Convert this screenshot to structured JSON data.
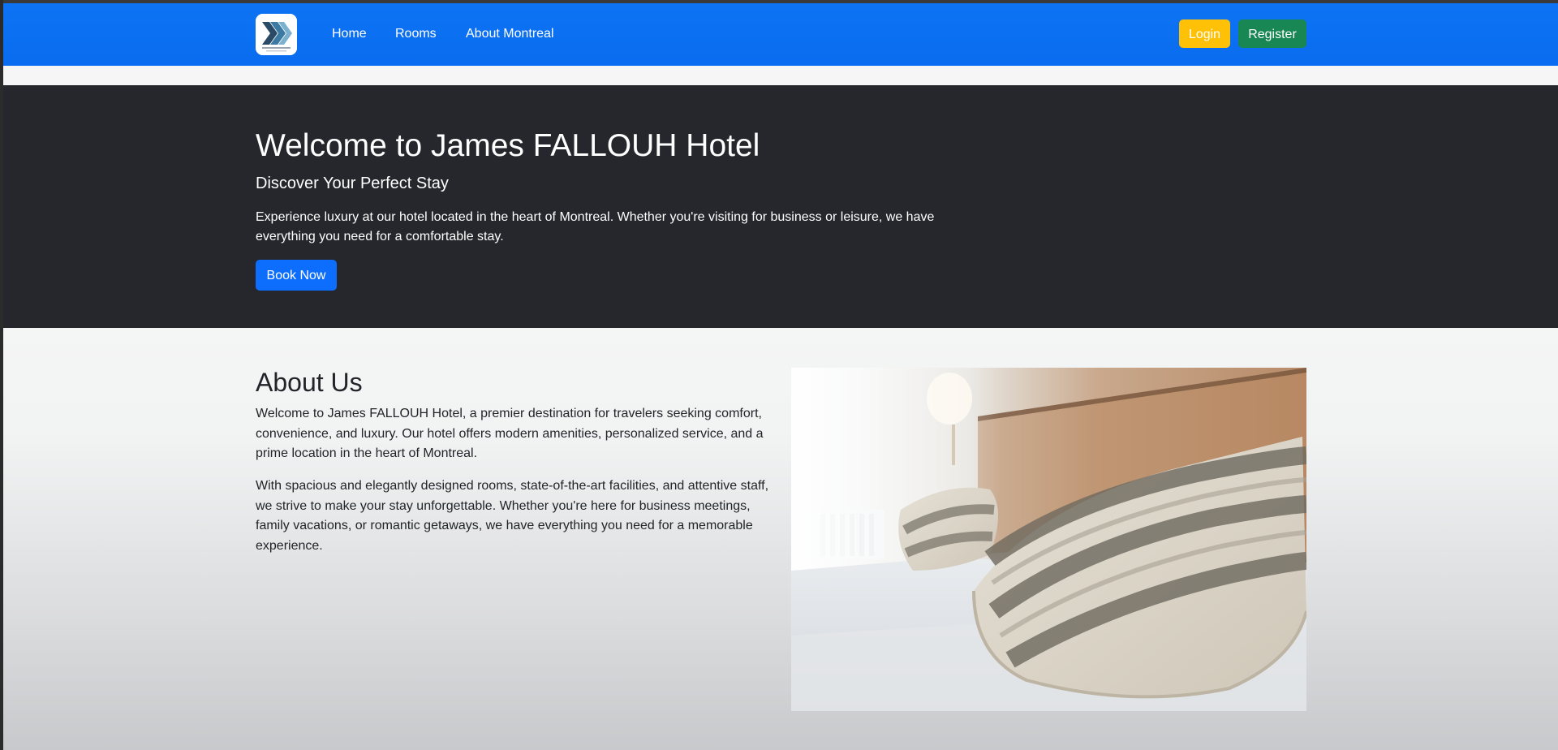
{
  "navbar": {
    "logo": "hotel-logo-icon",
    "links": [
      "Home",
      "Rooms",
      "About Montreal"
    ],
    "login_label": "Login",
    "register_label": "Register",
    "colors": {
      "navbar": "#0d73f3",
      "login": "#ffc107",
      "register": "#198754"
    }
  },
  "hero": {
    "title": "Welcome to James FALLOUH Hotel",
    "subtitle": "Discover Your Perfect Stay",
    "text": "Experience luxury at our hotel located in the heart of Montreal. Whether you're visiting for business or leisure, we have everything you need for a comfortable stay.",
    "book_label": "Book Now",
    "colors": {
      "background": "#25272c",
      "book": "#0d6efd"
    }
  },
  "about": {
    "title": "About Us",
    "paragraphs": [
      "Welcome to James FALLOUH Hotel, a premier destination for travelers seeking comfort, convenience, and luxury. Our hotel offers modern amenities, personalized service, and a prime location in the heart of Montreal.",
      "With spacious and elegantly designed rooms, state-of-the-art facilities, and attentive staff, we strive to make your stay unforgettable. Whether you're here for business meetings, family vacations, or romantic getaways, we have everything you need for a memorable experience."
    ],
    "image": "hotel-bed-pillows-photo"
  }
}
